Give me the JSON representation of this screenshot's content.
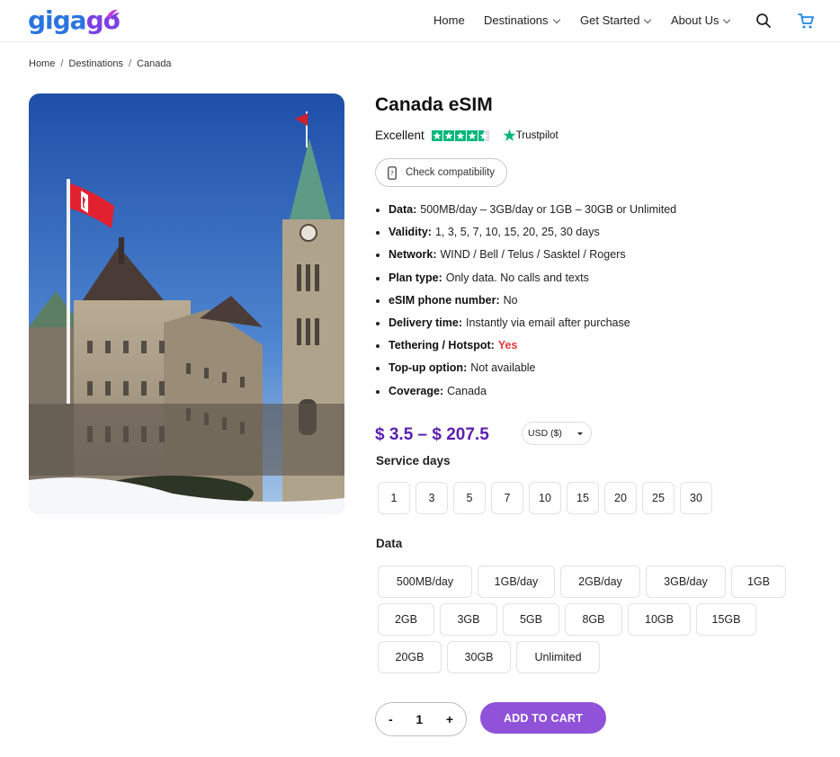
{
  "brand": {
    "logo_text": "gigago"
  },
  "nav": {
    "items": [
      {
        "label": "Home"
      },
      {
        "label": "Destinations"
      },
      {
        "label": "Get Started"
      },
      {
        "label": "About Us"
      }
    ],
    "search_icon": "search-icon",
    "cart_icon": "cart-icon"
  },
  "breadcrumb": {
    "home": "Home",
    "destinations": "Destinations",
    "current": "Canada",
    "separator": "/"
  },
  "product": {
    "title": "Canada eSIM",
    "rating_label": "Excellent",
    "rating_stars": 4.5,
    "trustpilot_label": "Trustpilot",
    "check_compatibility": "Check compatibility",
    "features": [
      {
        "label": "Data:",
        "value": "500MB/day – 3GB/day or 1GB – 30GB or Unlimited"
      },
      {
        "label": "Validity:",
        "value": "1, 3, 5, 7, 10, 15, 20, 25, 30 days"
      },
      {
        "label": "Network:",
        "value": "WIND / Bell / Telus / Sasktel / Rogers"
      },
      {
        "label": "Plan type:",
        "value": "Only data. No calls and texts"
      },
      {
        "label": "eSIM phone number:",
        "value": "No"
      },
      {
        "label": "Delivery time:",
        "value": "Instantly via email after purchase"
      },
      {
        "label": "Tethering / Hotspot:",
        "value": "Yes"
      },
      {
        "label": "Top-up option:",
        "value": "Not available"
      },
      {
        "label": "Coverage:",
        "value": "Canada"
      }
    ],
    "price_range": "$ 3.5 – $ 207.5",
    "currency": "USD ($)",
    "service_days_label": "Service days",
    "service_days": [
      "1",
      "3",
      "5",
      "7",
      "10",
      "15",
      "20",
      "25",
      "30"
    ],
    "data_label": "Data",
    "data_options": [
      "500MB/day",
      "1GB/day",
      "2GB/day",
      "3GB/day",
      "1GB",
      "2GB",
      "3GB",
      "5GB",
      "8GB",
      "10GB",
      "15GB",
      "20GB",
      "30GB",
      "Unlimited"
    ],
    "quantity": "1",
    "minus": "-",
    "plus": "+",
    "add_to_cart": "ADD TO CART"
  },
  "colors": {
    "brand_blue": "#2b74e0",
    "brand_purple": "#7b3fe4",
    "price": "#5b1fae",
    "cart_button": "#9052d8",
    "trustpilot_green": "#00b67a",
    "hotspot_yes": "#e23a3a"
  }
}
